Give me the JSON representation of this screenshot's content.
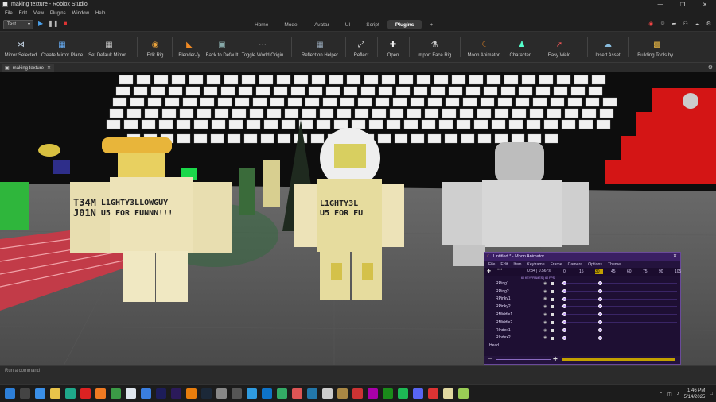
{
  "window": {
    "title": "making texture - Roblox Studio"
  },
  "menu": [
    "File",
    "Edit",
    "View",
    "Plugins",
    "Window",
    "Help"
  ],
  "toolbar_top": {
    "test_select": "Test"
  },
  "ribbon_tabs": [
    {
      "label": "Home",
      "active": false
    },
    {
      "label": "Model",
      "active": false
    },
    {
      "label": "Avatar",
      "active": false
    },
    {
      "label": "UI",
      "active": false
    },
    {
      "label": "Script",
      "active": false
    },
    {
      "label": "Plugins",
      "active": true
    },
    {
      "label": "+",
      "active": false
    }
  ],
  "tools": [
    {
      "label": "Mirror Selected",
      "icon": "mirror-icon"
    },
    {
      "label": "Create Mirror Plane",
      "icon": "grid-icon"
    },
    {
      "label": "Set Default Mirror...",
      "icon": "grid-icon"
    },
    {
      "label": "Edit Rig",
      "icon": "rig-icon"
    },
    {
      "label": "Blender-fy",
      "icon": "blender-icon"
    },
    {
      "label": "Back to Default",
      "icon": "reset-icon"
    },
    {
      "label": "Toggle World Origin",
      "icon": "origin-icon"
    },
    {
      "label": "Reflection Helper",
      "icon": "reflection-icon"
    },
    {
      "label": "Reflect",
      "icon": "reflect-icon"
    },
    {
      "label": "Open",
      "icon": "open-icon"
    },
    {
      "label": "Import Face Rig",
      "icon": "face-rig-icon"
    },
    {
      "label": "Moon Animator...",
      "icon": "moon-icon"
    },
    {
      "label": "Character...",
      "icon": "character-icon"
    },
    {
      "label": "Easy Weld",
      "icon": "weld-icon"
    },
    {
      "label": "Insert Asset",
      "icon": "insert-icon"
    },
    {
      "label": "Building Tools by...",
      "icon": "building-icon"
    }
  ],
  "doc_tab": {
    "label": "making texture"
  },
  "shirts": {
    "left_line1": "T34M",
    "left_line2": "J01N",
    "left_line3": "L1GHTY3LLOWGUY",
    "left_line4": "U5 FOR FUNNN!!!",
    "mid_line1": "L1GHTY3L",
    "mid_line2": "U5 FOR FU"
  },
  "moon": {
    "title": "Untitled * - Moon Animator",
    "menu": [
      "File",
      "Edit",
      "Item",
      "Keyframe",
      "Frame",
      "Camera",
      "Options",
      "Theme"
    ],
    "time": "0:34 | 0.567s",
    "fps": "60 KEYFRAMES | 60 FPS",
    "ticks": [
      "0",
      "15",
      "30",
      "45",
      "60",
      "75",
      "90",
      "105"
    ],
    "rows": [
      "RRing1",
      "RRing2",
      "RPinky1",
      "RPinky2",
      "RMiddle1",
      "RMiddle2",
      "RIndex1",
      "RIndex2",
      "Head"
    ]
  },
  "command_bar": {
    "placeholder": "Run a command"
  },
  "clock": {
    "time": "1:46 PM",
    "date": "5/14/2025"
  },
  "colors": {
    "accent": "#6a4a9a",
    "sky_tile": "#f2f2f2",
    "shirt": "#e8deb0",
    "dummy": "#c8c8c8"
  }
}
